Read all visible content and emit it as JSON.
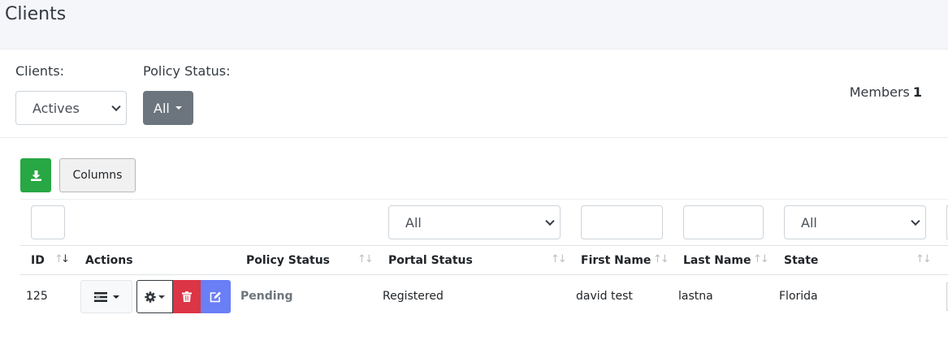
{
  "page": {
    "title": "Clients"
  },
  "filters": {
    "clients_label": "Clients:",
    "clients_value": "Actives",
    "policy_status_label": "Policy Status:",
    "policy_status_value": "All"
  },
  "members": {
    "label": "Members",
    "count": "1"
  },
  "toolbar": {
    "columns_label": "Columns",
    "download_icon": "download-icon"
  },
  "table": {
    "filter_values": {
      "portal_status": "All",
      "state": "All"
    },
    "headers": {
      "id": "ID",
      "actions": "Actions",
      "policy_status": "Policy Status",
      "portal_status": "Portal Status",
      "first_name": "First Name",
      "last_name": "Last Name",
      "state": "State"
    },
    "rows": [
      {
        "id": "125",
        "policy_status": "Pending",
        "portal_status": "Registered",
        "first_name": "david test",
        "last_name": "lastna",
        "state": "Florida"
      }
    ]
  },
  "colors": {
    "download_button": "#28a745",
    "delete_button": "#dc3545",
    "edit_button": "#6a7ef5",
    "secondary_button": "#6c757d"
  }
}
